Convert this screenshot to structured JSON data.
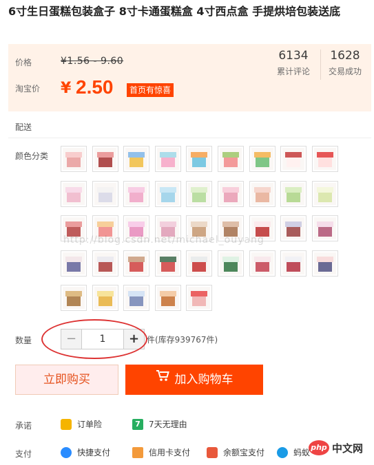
{
  "product": {
    "title": "6寸生日蛋糕包装盒子 8寸卡通蛋糕盒 4寸西点盒 手提烘培包装送底"
  },
  "price": {
    "label": "价格",
    "range": "¥1.56 - 9.60",
    "promo_label": "淘宝价",
    "symbol": "¥",
    "value": "2.50",
    "promo_tag": "首页有惊喜"
  },
  "stats": [
    {
      "value": "6134",
      "label": "累计评论"
    },
    {
      "value": "1628",
      "label": "交易成功"
    }
  ],
  "delivery": {
    "label": "配送"
  },
  "colors": {
    "label": "颜色分类",
    "count": 41
  },
  "watermark": "http://blog.csdn.net/michael_ouyang",
  "quantity": {
    "label": "数量",
    "minus": "−",
    "value": "1",
    "plus": "+",
    "stock": "件(库存939767件)"
  },
  "actions": {
    "buy_now": "立即购买",
    "add_to_cart": "加入购物车"
  },
  "promise": {
    "label": "承诺",
    "items": [
      {
        "icon": "order-insurance-icon",
        "text": "订单险"
      },
      {
        "icon": "seven-day-return-icon",
        "text": "7天无理由"
      }
    ]
  },
  "payment": {
    "label": "支付",
    "items": [
      {
        "icon": "quick-pay-icon",
        "text": "快捷支付"
      },
      {
        "icon": "credit-card-icon",
        "text": "信用卡支付"
      },
      {
        "icon": "yuebao-icon",
        "text": "余额宝支付"
      },
      {
        "icon": "ant-icon",
        "text": "蚂蚁"
      }
    ]
  },
  "brand": {
    "php": "php",
    "cn": "中文网"
  },
  "theme": {
    "accent": "#ff4400",
    "panel_bg": "#fff2e8"
  }
}
